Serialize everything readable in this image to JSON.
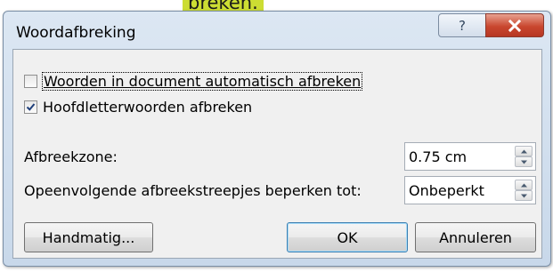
{
  "background_text": "breken.",
  "dialog": {
    "title": "Woordafbreking",
    "help_glyph": "?",
    "close_glyph": "X"
  },
  "options": {
    "auto_hyphenate": {
      "label": "Woorden in document automatisch afbreken",
      "checked": false
    },
    "caps_hyphenate": {
      "label": "Hoofdletterwoorden afbreken",
      "checked": true
    }
  },
  "zone": {
    "label": "Afbreekzone:",
    "value": "0.75 cm"
  },
  "limit": {
    "label": "Opeenvolgende afbreekstreepjes beperken tot:",
    "value": "Onbeperkt"
  },
  "buttons": {
    "manual": "Handmatig...",
    "ok": "OK",
    "cancel": "Annuleren"
  },
  "colors": {
    "dialog_frame": "#c8d8ea",
    "close_button": "#c9472f",
    "client_bg": "#f0f0f0"
  }
}
